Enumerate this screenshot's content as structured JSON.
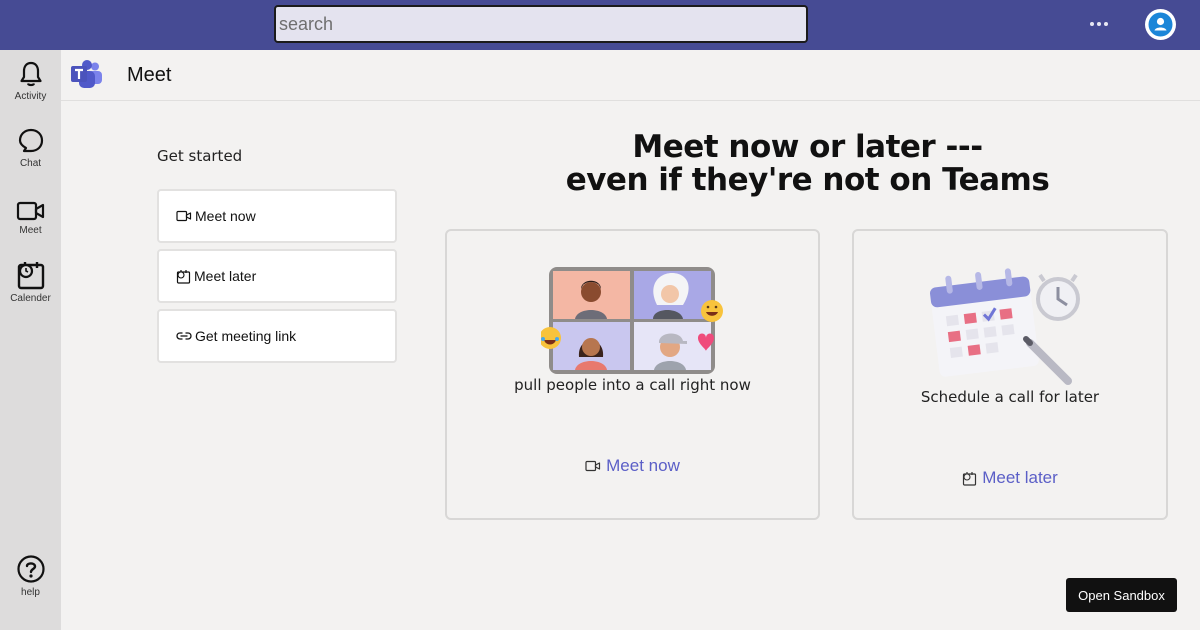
{
  "search": {
    "placeholder": "search"
  },
  "topbar": {
    "more_icon": "more-horizontal-icon",
    "avatar_icon": "person-icon"
  },
  "rail": {
    "items": [
      {
        "label": "Activity",
        "icon": "bell-icon"
      },
      {
        "label": "Chat",
        "icon": "chat-bubble-icon"
      },
      {
        "label": "Meet",
        "icon": "video-camera-icon"
      },
      {
        "label": "Calender",
        "icon": "calendar-clock-icon"
      }
    ],
    "help": {
      "label": "help",
      "icon": "question-circle-icon"
    }
  },
  "header": {
    "title": "Meet",
    "logo_icon": "teams-logo-icon"
  },
  "get_started": {
    "heading": "Get started",
    "buttons": [
      {
        "label": "Meet now",
        "icon": "video-camera-icon"
      },
      {
        "label": "Meet later",
        "icon": "calendar-clock-icon"
      },
      {
        "label": "Get meeting link",
        "icon": "link-icon"
      }
    ]
  },
  "headline": {
    "line1": "Meet now or later ---",
    "line2": "even if they're not on Teams"
  },
  "cards": [
    {
      "description": "pull people into a call right now",
      "link_label": "Meet now",
      "illustration": "video-call-grid-illustration"
    },
    {
      "description": "Schedule a call for later",
      "link_label": "Meet later",
      "illustration": "calendar-alarm-illustration"
    }
  ],
  "sandbox_button": {
    "label": "Open Sandbox"
  },
  "colors": {
    "topbar": "#464b94",
    "rail": "#dddcdc",
    "accent": "#5b5fc7",
    "background": "#f3f2f1"
  }
}
